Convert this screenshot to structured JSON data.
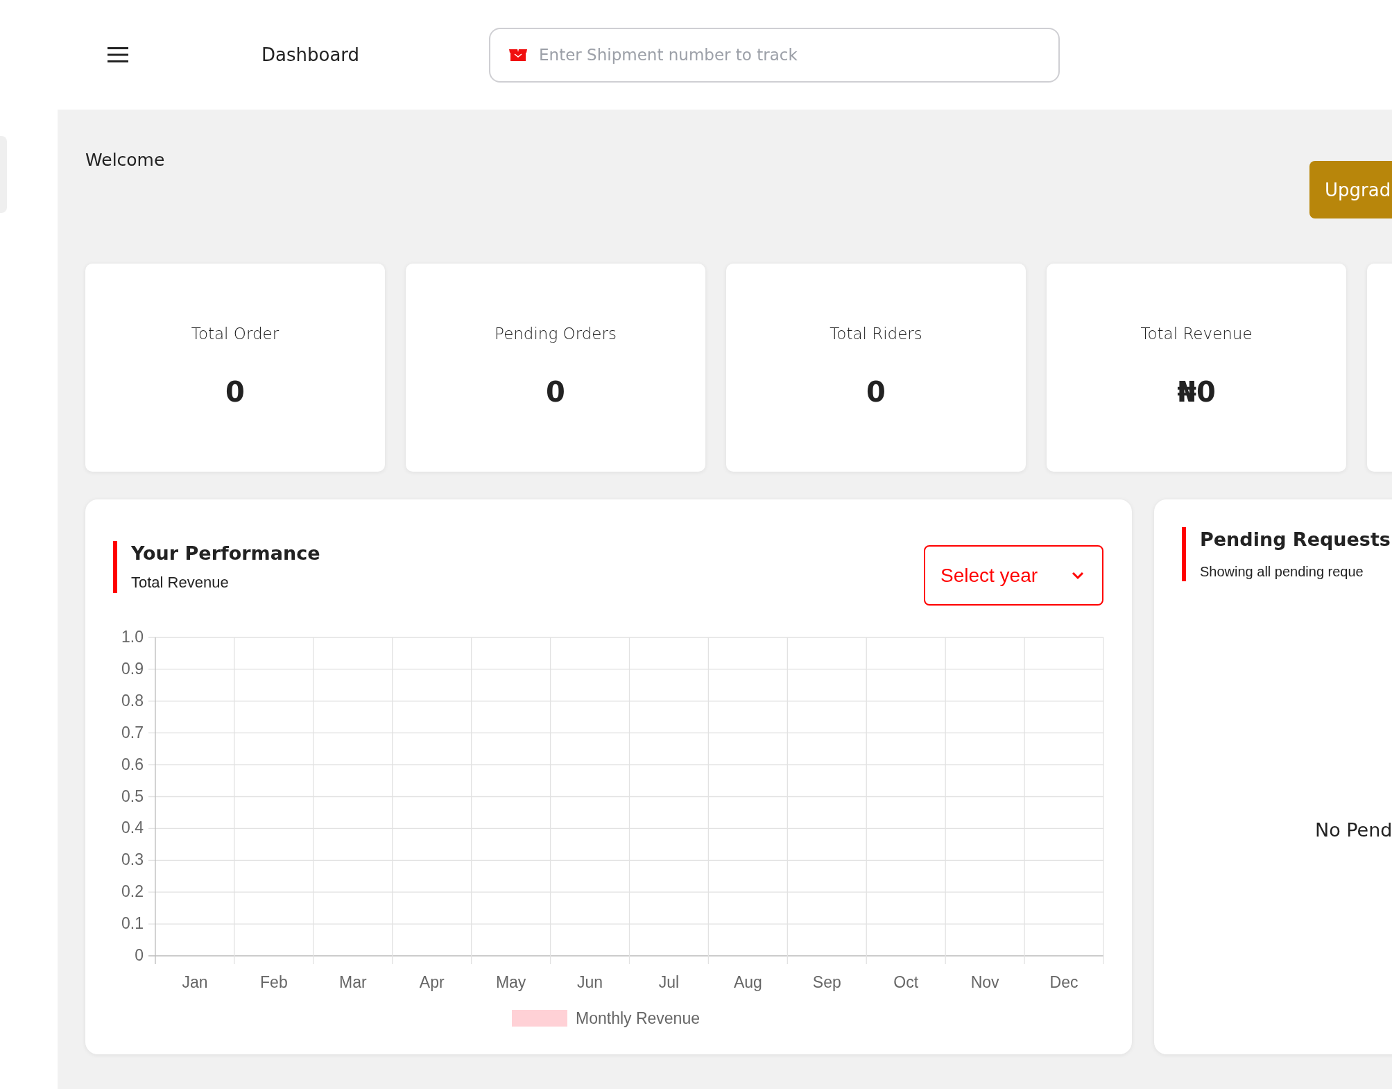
{
  "header": {
    "title": "Dashboard",
    "search": {
      "placeholder": "Enter Shipment number to track"
    }
  },
  "welcome": "Welcome",
  "upgrade_button": "Upgrad",
  "stats": [
    {
      "label": "Total Order",
      "value": "0"
    },
    {
      "label": "Pending Orders",
      "value": "0"
    },
    {
      "label": "Total Riders",
      "value": "0"
    },
    {
      "label": "Total Revenue",
      "value": "₦0"
    }
  ],
  "performance": {
    "title": "Your Performance",
    "subtitle": "Total Revenue",
    "year_select": {
      "placeholder": "Select year"
    },
    "chart_data": {
      "type": "bar",
      "categories": [
        "Jan",
        "Feb",
        "Mar",
        "Apr",
        "May",
        "Jun",
        "Jul",
        "Aug",
        "Sep",
        "Oct",
        "Nov",
        "Dec"
      ],
      "series": [
        {
          "name": "Monthly Revenue",
          "color": "#ffd1d6",
          "values": [
            null,
            null,
            null,
            null,
            null,
            null,
            null,
            null,
            null,
            null,
            null,
            null
          ]
        }
      ],
      "grid": true,
      "ylim": [
        0,
        1
      ],
      "yticks": [
        0,
        0.1,
        0.2,
        0.3,
        0.4,
        0.5,
        0.6,
        0.7,
        0.8,
        0.9,
        {
          "value": 1,
          "label": "1.0"
        }
      ]
    }
  },
  "pending_requests": {
    "title": "Pending Requests",
    "subtitle": "Showing all pending reque",
    "empty_message": "No Pend"
  }
}
